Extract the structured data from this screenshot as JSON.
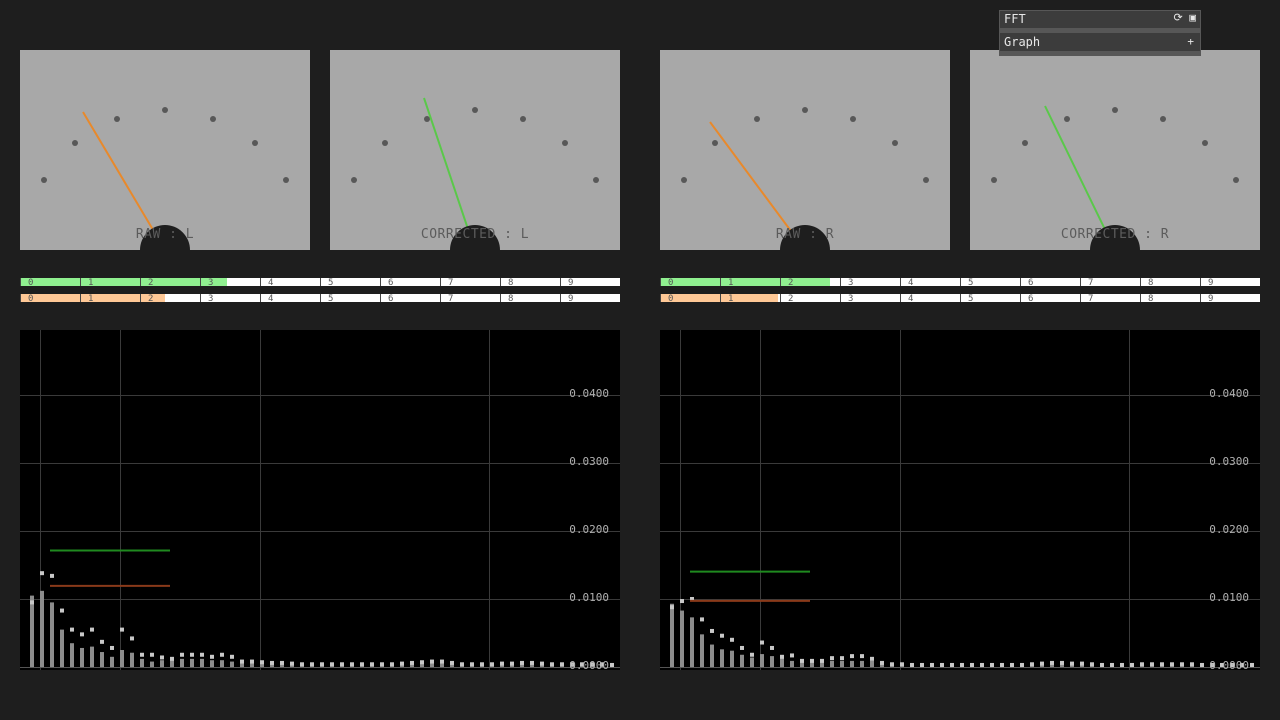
{
  "meters": [
    {
      "label": "RAW : L",
      "needle_color": "#e8892b"
    },
    {
      "label": "CORRECTED : L",
      "needle_color": "#5ac84a"
    },
    {
      "label": "RAW : R",
      "needle_color": "#e8892b"
    },
    {
      "label": "CORRECTED : R",
      "needle_color": "#5ac84a"
    }
  ],
  "level_bars": [
    {
      "channel": "L",
      "kind": "corrected",
      "fill_fraction": 0.345,
      "fill_color": "#90f090"
    },
    {
      "channel": "L",
      "kind": "raw",
      "fill_fraction": 0.242,
      "fill_color": "#ffc896"
    },
    {
      "channel": "R",
      "kind": "corrected",
      "fill_fraction": 0.283,
      "fill_color": "#90f090"
    },
    {
      "channel": "R",
      "kind": "raw",
      "fill_fraction": 0.197,
      "fill_color": "#ffc896"
    }
  ],
  "scale_ticks": [
    "0",
    "1",
    "2",
    "3",
    "4",
    "5",
    "6",
    "7",
    "8",
    "9"
  ],
  "fft_panel": {
    "title": "FFT",
    "row_label": "Graph",
    "refresh_icon": "refresh-icon",
    "save_icon": "save-icon",
    "add_icon": "plus-icon"
  },
  "chart_data": [
    {
      "type": "bar",
      "channel": "L",
      "y_tick_labels": [
        "0.0400",
        "0.0300",
        "0.0200",
        "0.0100",
        "0.0000"
      ],
      "ylim": [
        0,
        0.05
      ],
      "grid": true,
      "reference_lines": [
        {
          "color": "#1f8a1f",
          "value": 0.0172
        },
        {
          "color": "#8a3a1a",
          "value": 0.012
        }
      ],
      "bars": [
        0.0105,
        0.0112,
        0.0095,
        0.0055,
        0.0035,
        0.0028,
        0.003,
        0.0022,
        0.0015,
        0.0025,
        0.0021,
        0.0012,
        0.0008,
        0.001,
        0.0012,
        0.0012,
        0.0012,
        0.0012,
        0.001,
        0.001,
        0.0008,
        0.0009,
        0.0009,
        0.0008,
        0.0007,
        0.0007,
        0.0006,
        0.0005,
        0.0004,
        0.0004,
        0.0004,
        0.0004,
        0.0004,
        0.0004,
        0.0004,
        0.0004,
        0.0004,
        0.0005,
        0.0005,
        0.0006,
        0.0007,
        0.0008,
        0.0006,
        0.0004,
        0.0004,
        0.0004,
        0.0004,
        0.0005,
        0.0005,
        0.0006,
        0.0006,
        0.0005,
        0.0004,
        0.0004,
        0.0004,
        0.0004,
        0.0004,
        0.0004,
        0.0003
      ],
      "peaks": [
        0.0095,
        0.0138,
        0.0134,
        0.0083,
        0.0055,
        0.0048,
        0.0055,
        0.0037,
        0.0028,
        0.0055,
        0.0042,
        0.0018,
        0.0018,
        0.0014,
        0.0012,
        0.0018,
        0.0018,
        0.0018,
        0.0015,
        0.0018,
        0.0015,
        0.0008,
        0.0008,
        0.0007,
        0.0006,
        0.0006,
        0.0005,
        0.0004,
        0.0004,
        0.0004,
        0.0004,
        0.0004,
        0.0004,
        0.0004,
        0.0004,
        0.0004,
        0.0004,
        0.0005,
        0.0006,
        0.0007,
        0.0008,
        0.0008,
        0.0006,
        0.0004,
        0.0004,
        0.0004,
        0.0004,
        0.0005,
        0.0005,
        0.0006,
        0.0006,
        0.0005,
        0.0004,
        0.0004,
        0.0004,
        0.0004,
        0.0004,
        0.0004,
        0.0003
      ]
    },
    {
      "type": "bar",
      "channel": "R",
      "y_tick_labels": [
        "0.0400",
        "0.0300",
        "0.0200",
        "0.0100",
        "0.0000"
      ],
      "ylim": [
        0,
        0.05
      ],
      "grid": true,
      "reference_lines": [
        {
          "color": "#1f8a1f",
          "value": 0.0141
        },
        {
          "color": "#8a3a1a",
          "value": 0.0098
        }
      ],
      "bars": [
        0.0093,
        0.0083,
        0.0073,
        0.0048,
        0.0033,
        0.0026,
        0.0024,
        0.0018,
        0.0014,
        0.0019,
        0.0016,
        0.0013,
        0.0009,
        0.0009,
        0.0009,
        0.0009,
        0.0009,
        0.0009,
        0.0009,
        0.0009,
        0.0009,
        0.0006,
        0.0004,
        0.0004,
        0.0003,
        0.0003,
        0.0003,
        0.0003,
        0.0003,
        0.0003,
        0.0003,
        0.0003,
        0.0003,
        0.0003,
        0.0003,
        0.0003,
        0.0004,
        0.0004,
        0.0005,
        0.0005,
        0.0005,
        0.0005,
        0.0004,
        0.0003,
        0.0003,
        0.0003,
        0.0003,
        0.0004,
        0.0004,
        0.0004,
        0.0004,
        0.0004,
        0.0004,
        0.0003,
        0.0003,
        0.0003,
        0.0003,
        0.0003,
        0.0003
      ],
      "peaks": [
        0.0088,
        0.0097,
        0.01,
        0.007,
        0.0053,
        0.0046,
        0.004,
        0.0028,
        0.0018,
        0.0036,
        0.0028,
        0.0015,
        0.0017,
        0.0009,
        0.0009,
        0.0009,
        0.0013,
        0.0013,
        0.0016,
        0.0016,
        0.0012,
        0.0006,
        0.0004,
        0.0004,
        0.0003,
        0.0003,
        0.0003,
        0.0003,
        0.0003,
        0.0003,
        0.0003,
        0.0003,
        0.0003,
        0.0003,
        0.0003,
        0.0003,
        0.0004,
        0.0005,
        0.0006,
        0.0006,
        0.0005,
        0.0005,
        0.0004,
        0.0003,
        0.0003,
        0.0003,
        0.0003,
        0.0004,
        0.0004,
        0.0004,
        0.0004,
        0.0004,
        0.0004,
        0.0003,
        0.0003,
        0.0003,
        0.0003,
        0.0003,
        0.0003
      ]
    }
  ]
}
